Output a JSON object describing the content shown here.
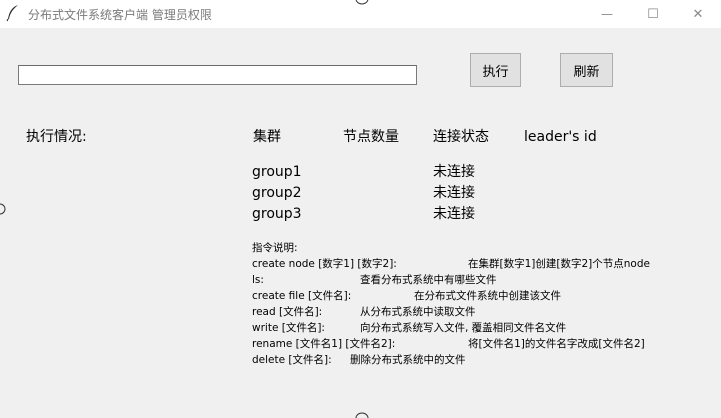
{
  "window": {
    "title": "分布式文件系统客户端 管理员权限",
    "minimize_glyph": "—",
    "maximize_glyph": "☐",
    "close_glyph": "✕"
  },
  "toolbar": {
    "command_value": "",
    "execute_label": "执行",
    "refresh_label": "刷新"
  },
  "status": {
    "label": "执行情况:"
  },
  "table": {
    "headers": [
      "集群",
      "节点数量",
      "连接状态",
      "leader's id"
    ],
    "rows": [
      {
        "group": "group1",
        "nodes": "",
        "state": "未连接",
        "leader": ""
      },
      {
        "group": "group2",
        "nodes": "",
        "state": "未连接",
        "leader": ""
      },
      {
        "group": "group3",
        "nodes": "",
        "state": "未连接",
        "leader": ""
      }
    ]
  },
  "help": {
    "title": "指令说明:",
    "lines": [
      {
        "cmd": "create node [数字1] [数字2]:",
        "desc": "在集群[数字1]创建[数字2]个节点node"
      },
      {
        "cmd": "ls:",
        "desc": "查看分布式系统中有哪些文件"
      },
      {
        "cmd": "create file [文件名]:",
        "desc": "在分布式文件系统中创建该文件"
      },
      {
        "cmd": "read [文件名]:",
        "desc": "从分布式系统中读取文件"
      },
      {
        "cmd": "write [文件名]:",
        "desc": "向分布式系统写入文件, 覆盖相同文件名文件"
      },
      {
        "cmd": "rename [文件名1] [文件名2]:",
        "desc": "将[文件名1]的文件名字改成[文件名2]"
      },
      {
        "cmd": "delete [文件名]:",
        "desc": "删除分布式系统中的文件"
      }
    ]
  }
}
